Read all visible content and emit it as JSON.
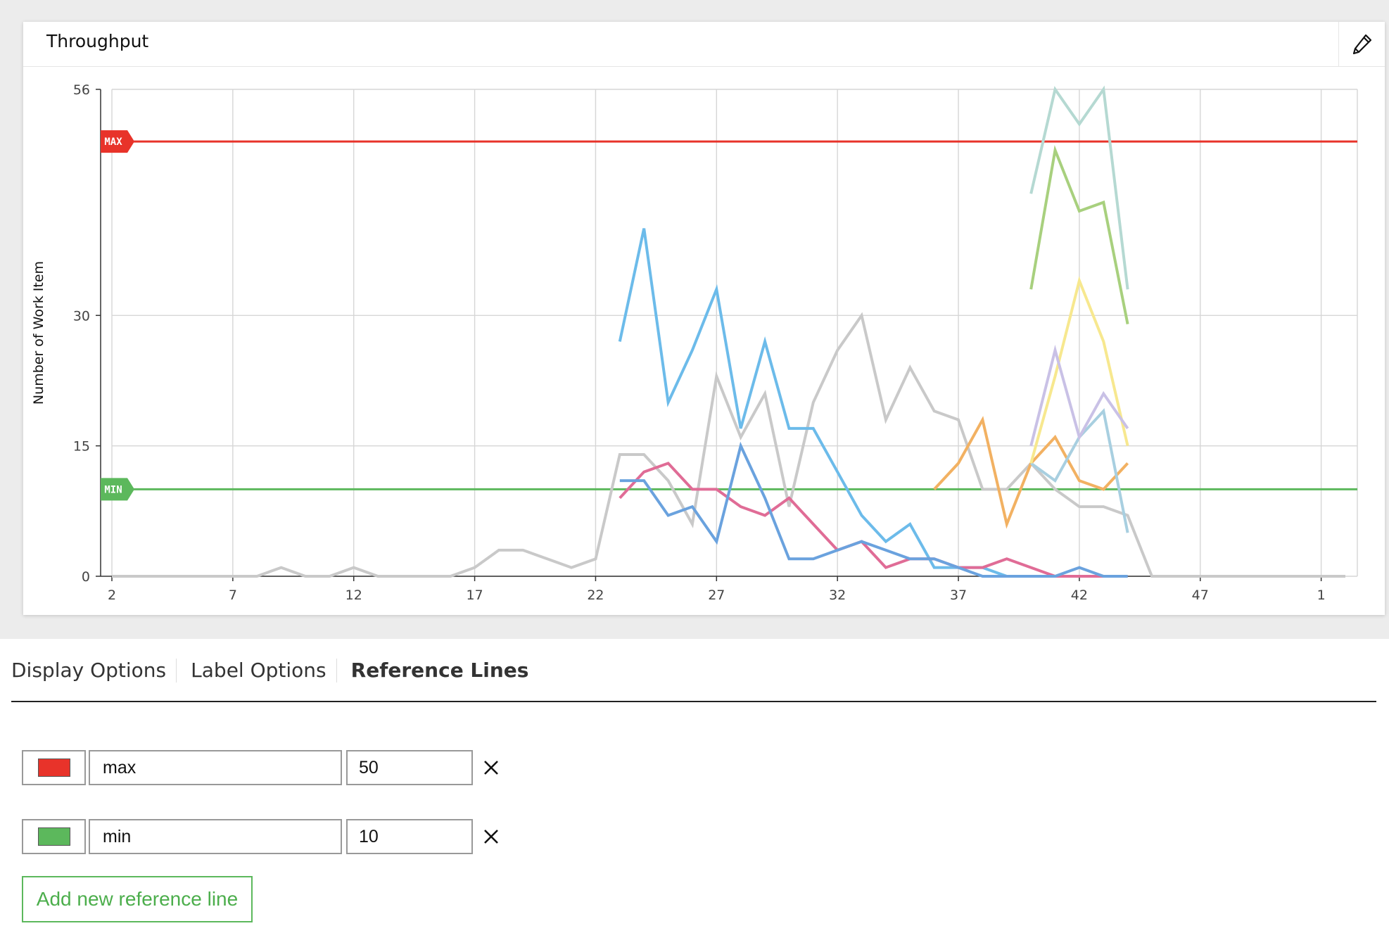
{
  "panel": {
    "title": "Throughput"
  },
  "chart_data": {
    "type": "line",
    "title": "",
    "xlabel": "",
    "ylabel": "Number of Work Item",
    "x": [
      2,
      3,
      4,
      5,
      6,
      7,
      8,
      9,
      10,
      11,
      12,
      13,
      14,
      15,
      16,
      17,
      18,
      19,
      20,
      21,
      22,
      23,
      24,
      25,
      26,
      27,
      28,
      29,
      30,
      31,
      32,
      33,
      34,
      35,
      36,
      37,
      38,
      39,
      40,
      41,
      42,
      43,
      44,
      45,
      46,
      47,
      48,
      49,
      50,
      51,
      52,
      1
    ],
    "x_tick_labels": [
      "2",
      "7",
      "12",
      "17",
      "22",
      "27",
      "32",
      "37",
      "42",
      "47",
      "1"
    ],
    "y_ticks": [
      0,
      15,
      30,
      56
    ],
    "ylim": [
      0,
      56
    ],
    "grid": true,
    "series": [
      {
        "color": "#c9c9c9",
        "start_index": 0,
        "values": [
          0,
          0,
          0,
          0,
          0,
          0,
          0,
          1,
          0,
          0,
          1,
          0,
          0,
          0,
          0,
          1,
          3,
          3,
          2,
          1,
          2,
          14,
          14,
          11,
          6,
          23,
          16,
          21,
          8,
          20,
          26,
          30,
          18,
          24,
          19,
          18,
          10,
          10,
          13,
          10,
          8,
          8,
          7,
          0,
          0,
          0,
          0,
          0,
          0,
          0,
          0,
          0
        ]
      },
      {
        "color": "#6cbbea",
        "start_index": 21,
        "values": [
          27,
          40,
          20,
          26,
          33,
          17,
          27,
          17,
          17,
          12,
          7,
          4,
          6,
          1,
          1,
          1,
          0,
          0,
          0,
          0,
          0,
          0
        ]
      },
      {
        "color": "#e06c96",
        "start_index": 21,
        "values": [
          9,
          12,
          13,
          10,
          10,
          8,
          7,
          9,
          6,
          3,
          4,
          1,
          2,
          2,
          1,
          1,
          2,
          1,
          0,
          0,
          0,
          0
        ]
      },
      {
        "color": "#6aa2de",
        "start_index": 21,
        "values": [
          11,
          11,
          7,
          8,
          4,
          15,
          9,
          2,
          2,
          3,
          4,
          3,
          2,
          2,
          1,
          0,
          0,
          0,
          0,
          1,
          0,
          0
        ]
      },
      {
        "color": "#f2b162",
        "start_index": 34,
        "values": [
          10,
          13,
          18,
          6,
          13,
          16,
          11,
          10,
          13
        ]
      },
      {
        "color": "#a8cfe0",
        "start_index": 38,
        "values": [
          13,
          11,
          16,
          19,
          5
        ]
      },
      {
        "color": "#b5d9d2",
        "start_index": 38,
        "values": [
          44,
          56,
          52,
          56,
          33
        ]
      },
      {
        "color": "#a8d07e",
        "start_index": 38,
        "values": [
          33,
          49,
          42,
          43,
          29
        ]
      },
      {
        "color": "#f7e88f",
        "start_index": 38,
        "values": [
          13,
          23,
          34,
          27,
          15
        ]
      },
      {
        "color": "#c9c1e6",
        "start_index": 38,
        "values": [
          15,
          26,
          16,
          21,
          17
        ]
      }
    ],
    "reference_lines": [
      {
        "label": "MAX",
        "value": 50,
        "color": "#e8332a"
      },
      {
        "label": "MIN",
        "value": 10,
        "color": "#5cb85c"
      }
    ]
  },
  "tabs": [
    {
      "label": "Display Options",
      "active": false
    },
    {
      "label": "Label Options",
      "active": false
    },
    {
      "label": "Reference Lines",
      "active": true
    }
  ],
  "reference_lines_form": [
    {
      "color": "#e8332a",
      "name": "max",
      "value": "50",
      "remove": "✕"
    },
    {
      "color": "#5cb85c",
      "name": "min",
      "value": "10",
      "remove": "✕"
    }
  ],
  "add_button": {
    "label": "Add new reference line"
  }
}
